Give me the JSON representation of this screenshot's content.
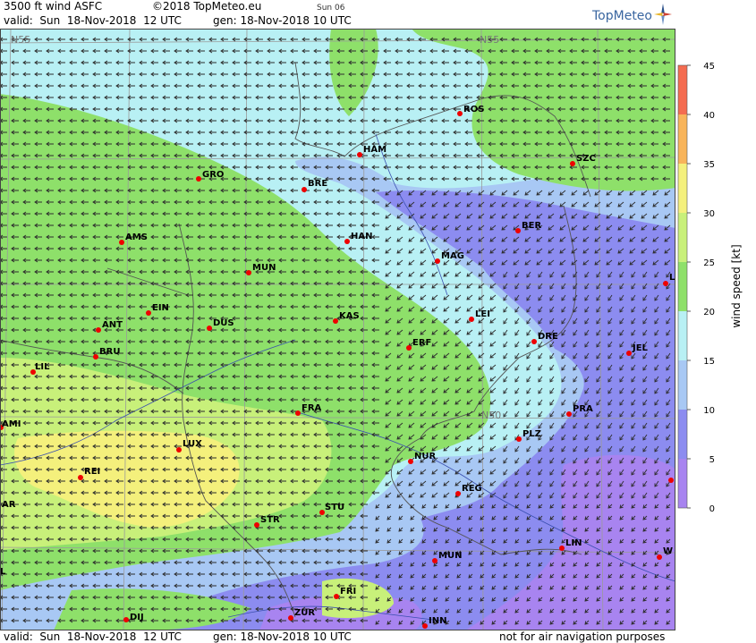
{
  "header": {
    "product": "3500 ft wind ASFC",
    "copyright": "©2018 TopMeteo.eu",
    "day_code": "Sun 06",
    "valid": "valid:  Sun  18-Nov-2018  12 UTC",
    "generated": "gen: 18-Nov-2018 10 UTC",
    "brand": "TopMeteo"
  },
  "footer": {
    "valid": "valid:  Sun  18-Nov-2018  12 UTC",
    "generated": "gen: 18-Nov-2018 10 UTC",
    "disclaimer": "not for air navigation purposes"
  },
  "legend": {
    "axis_label": "wind speed  [kt]",
    "ticks": [
      "0",
      "5",
      "10",
      "15",
      "20",
      "25",
      "30",
      "35",
      "40",
      "45"
    ],
    "bands": [
      {
        "from": 0,
        "to": 5,
        "color": "#a884f0"
      },
      {
        "from": 5,
        "to": 10,
        "color": "#8c8cf0"
      },
      {
        "from": 10,
        "to": 15,
        "color": "#a8c8f4"
      },
      {
        "from": 15,
        "to": 20,
        "color": "#b8f0f4"
      },
      {
        "from": 20,
        "to": 25,
        "color": "#8ee06a"
      },
      {
        "from": 25,
        "to": 30,
        "color": "#c8f07a"
      },
      {
        "from": 30,
        "to": 35,
        "color": "#f4f07c"
      },
      {
        "from": 35,
        "to": 40,
        "color": "#f8b45a"
      },
      {
        "from": 40,
        "to": 45,
        "color": "#f46c50"
      }
    ]
  },
  "grid_labels": [
    "N55",
    "N55",
    "N50"
  ],
  "cities": [
    "ROS",
    "HAM",
    "SZC",
    "GRO",
    "BRE",
    "BER",
    "AMS",
    "HAN",
    "MAG",
    "MUN",
    "L",
    "EIN",
    "LEI",
    "ANT",
    "DUS",
    "KAS",
    "DRE",
    "JEL",
    "ERF",
    "BRU",
    "LIL",
    "FRA",
    "PRA",
    "AMI",
    "PLZ",
    "LUX",
    "NUR",
    "REI",
    "REG",
    "AR",
    "STU",
    "STR",
    "LIN",
    "W",
    "MUN",
    "L",
    "FRI",
    "ZUR",
    "DIJ",
    "INN"
  ]
}
